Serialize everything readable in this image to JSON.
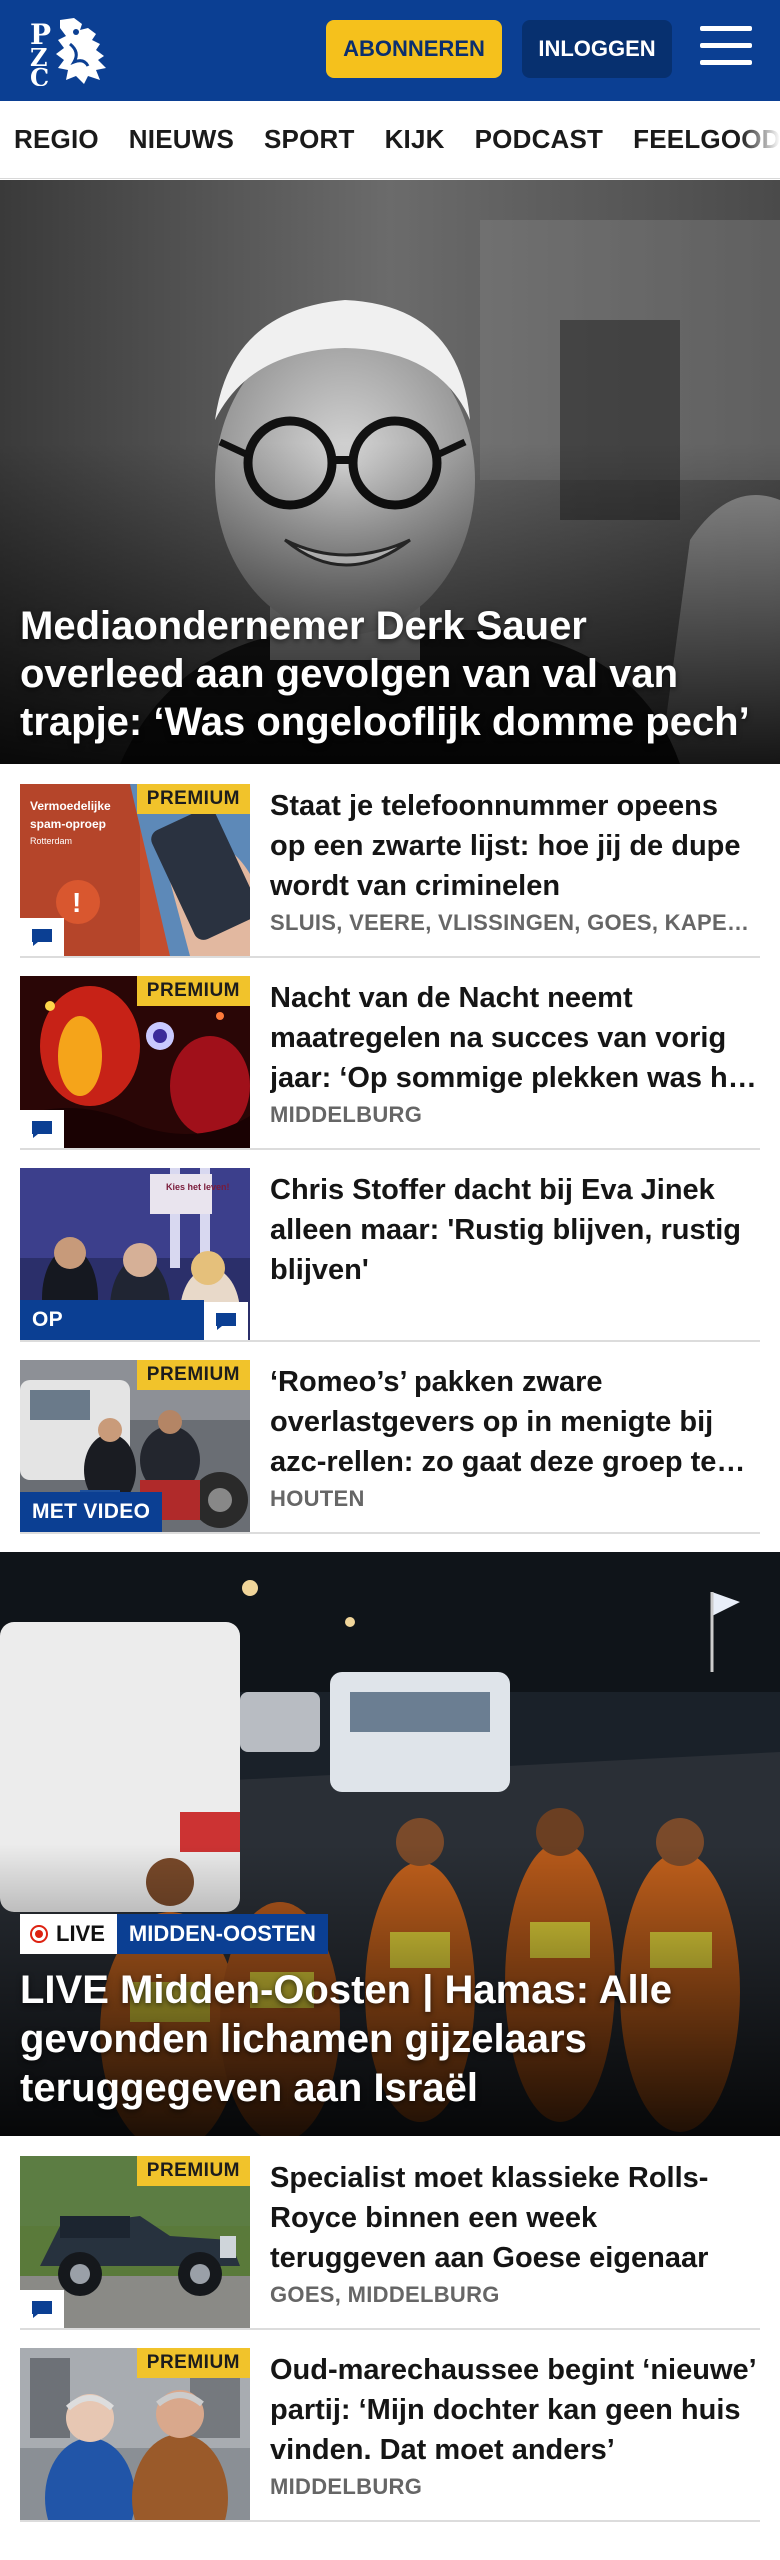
{
  "header": {
    "logo_text": "PZC",
    "subscribe_label": "ABONNEREN",
    "login_label": "INLOGGEN",
    "brand_color": "#0b3f93",
    "accent_color": "#f5c11c"
  },
  "nav": {
    "items": [
      "REGIO",
      "NIEUWS",
      "SPORT",
      "KIJK",
      "PODCAST",
      "FEELGOOD"
    ]
  },
  "hero": {
    "title": "Mediaondernemer Derk Sauer overleed aan gevolgen van val van trapje: ‘Was ongelooflijk domme pech’"
  },
  "articles": [
    {
      "title": "Staat je telefoonnummer opeens op een zwarte lijst: hoe jij de dupe wordt van criminelen",
      "meta": "SLUIS, VEERE, VLISSINGEN, GOES, KAPELLE, REIMERSWAAL",
      "badge": "PREMIUM",
      "thumb_caption_1": "Vermoedelijke",
      "thumb_caption_2": "spam-oproep",
      "thumb_caption_3": "Rotterdam",
      "icon": "comment-icon"
    },
    {
      "title": "Nacht van de Nacht neemt maatregelen na succes van vorig jaar: ‘Op sommige plekken was het gewoon te druk’",
      "meta": "MIDDELBURG",
      "badge": "PREMIUM",
      "icon": "comment-icon"
    },
    {
      "title": "Chris Stoffer dacht bij Eva Jinek alleen maar: 'Rustig blijven, rustig blijven'",
      "meta": "",
      "label": "OP CAMPAGN...",
      "thumb_sign": "Kies het leven!",
      "icon": "comment-icon"
    },
    {
      "title": "‘Romeo’s’ pakken zware overlastgevers op in menigte bij azc-rellen: zo gaat deze groep te werk",
      "meta": "HOUTEN",
      "badge": "PREMIUM",
      "label": "MET VIDEO"
    }
  ],
  "live": {
    "live_label": "LIVE",
    "category": "MIDDEN-OOSTEN",
    "title": "LIVE Midden-Oosten | Hamas: Alle gevonden lichamen gijzelaars teruggegeven aan Israël"
  },
  "articles2": [
    {
      "title": "Specialist moet klassieke Rolls-Royce binnen een week teruggeven aan Goese eigenaar",
      "meta": "GOES, MIDDELBURG",
      "badge": "PREMIUM",
      "icon": "comment-icon"
    },
    {
      "title": "Oud-marechaussee begint ‘nieuwe’ partij: ‘Mijn dochter kan geen huis vinden. Dat moet anders’",
      "meta": "MIDDELBURG",
      "badge": "PREMIUM"
    }
  ]
}
